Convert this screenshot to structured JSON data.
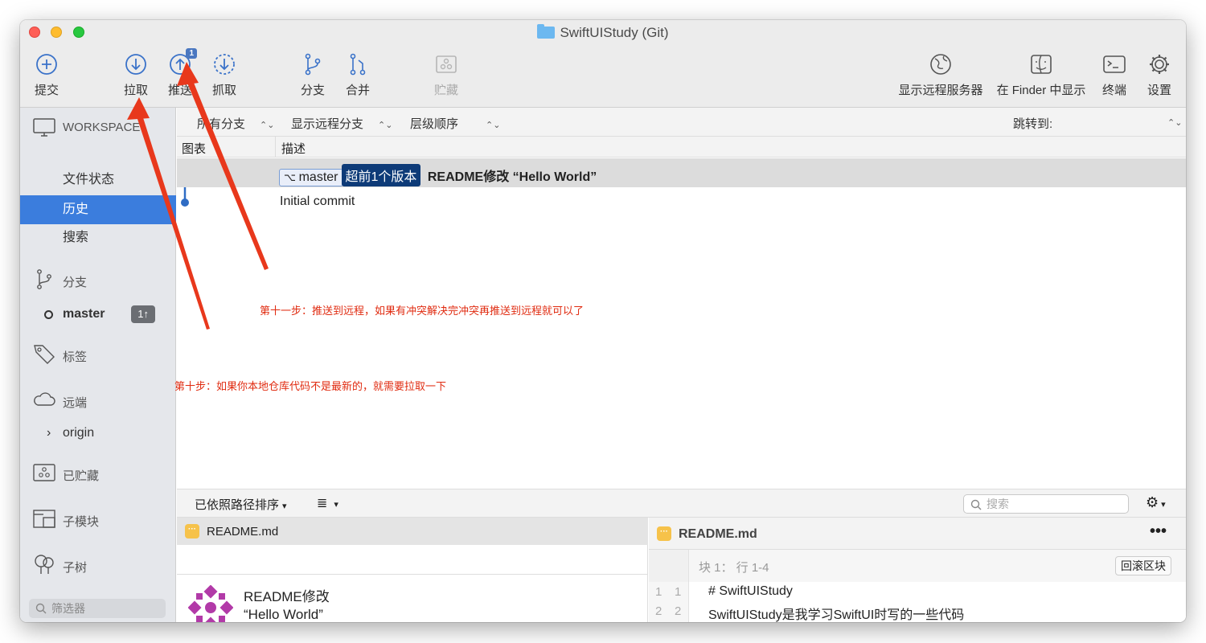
{
  "window": {
    "title": "SwiftUIStudy (Git)"
  },
  "toolbar": {
    "commit": "提交",
    "pull": "拉取",
    "push": "推送",
    "push_badge": "1",
    "fetch": "抓取",
    "branch": "分支",
    "merge": "合并",
    "stash": "贮藏",
    "show_remote": "显示远程服务器",
    "show_in_finder": "在 Finder 中显示",
    "terminal": "终端",
    "settings": "设置"
  },
  "sidebar": {
    "workspace": "WORKSPACE",
    "file_status": "文件状态",
    "history": "历史",
    "search": "搜索",
    "branches": "分支",
    "current_branch": "master",
    "current_branch_badge": "1↑",
    "tags": "标签",
    "remotes": "远端",
    "remote_origin": "origin",
    "stashes": "已贮藏",
    "submodules": "子模块",
    "subtrees": "子树",
    "filter_placeholder": "筛选器"
  },
  "filterbar": {
    "all_branches": "所有分支",
    "show_remote_branches": "显示远程分支",
    "ancestor_order": "层级顺序",
    "jump_to": "跳转到:"
  },
  "columns": {
    "graph": "图表",
    "description": "描述"
  },
  "commits": [
    {
      "branch": "master",
      "ahead": "超前1个版本",
      "message": "README修改 “Hello World”"
    },
    {
      "message": "Initial commit"
    }
  ],
  "annotations": {
    "step11": "第十一步：推送到远程，如果有冲突解决完冲突再推送到远程就可以了",
    "step10": "第十步：如果你本地仓库代码不是最新的，就需要拉取一下"
  },
  "bottombar": {
    "sort": "已依照路径排序",
    "search_placeholder": "搜索"
  },
  "files": [
    {
      "name": "README.md"
    }
  ],
  "commit_detail": {
    "line1": "README修改",
    "line2": "“Hello World”"
  },
  "diff": {
    "file": "README.md",
    "hunk": "块 1： 行 1-4",
    "revert": "回滚区块",
    "lines": [
      {
        "old": "1",
        "new": "1",
        "text": "# SwiftUIStudy"
      },
      {
        "old": "2",
        "new": "2",
        "text": "SwiftUIStudy是我学习SwiftUI时写的一些代码"
      }
    ]
  },
  "colors": {
    "accent": "#3b7ddd",
    "annotation": "#e02b10",
    "badge": "#4a77c0"
  }
}
